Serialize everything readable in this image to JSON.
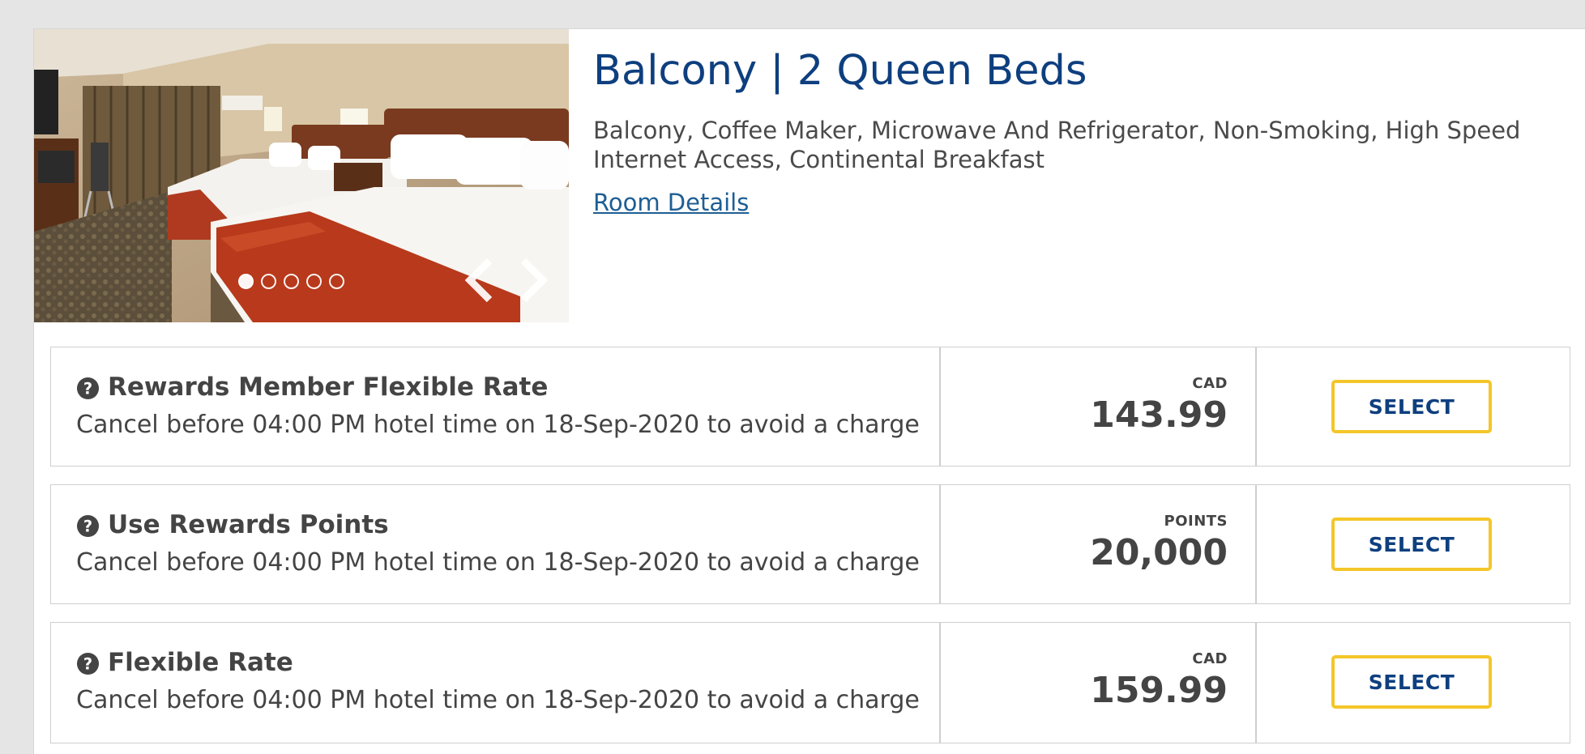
{
  "room": {
    "title": "Balcony | 2 Queen Beds",
    "description": "Balcony, Coffee Maker, Microwave And Refrigerator, Non-Smoking, High Speed Internet Access, Continental Breakfast",
    "details_link": "Room Details",
    "image_alt": "Hotel room with two queen beds",
    "carousel": {
      "slide_count": 5,
      "active_slide": 1
    }
  },
  "rates": [
    {
      "name": "Rewards Member Flexible Rate",
      "cancel_policy": "Cancel before 04:00 PM hotel time on 18-Sep-2020 to avoid a charge",
      "currency": "CAD",
      "amount": "143.99",
      "button": "SELECT"
    },
    {
      "name": "Use Rewards Points",
      "cancel_policy": "Cancel before 04:00 PM hotel time on 18-Sep-2020 to avoid a charge",
      "currency": "POINTS",
      "amount": "20,000",
      "button": "SELECT"
    },
    {
      "name": "Flexible Rate",
      "cancel_policy": "Cancel before 04:00 PM hotel time on 18-Sep-2020 to avoid a charge",
      "currency": "CAD",
      "amount": "159.99",
      "button": "SELECT"
    }
  ],
  "colors": {
    "title": "#0e3f7f",
    "link": "#1e5e94",
    "button_border": "#f4c62a",
    "button_text": "#0e3f7f",
    "text": "#444444"
  },
  "icons": {
    "help": "question-circle-icon",
    "prev": "chevron-left-icon",
    "next": "chevron-right-icon"
  }
}
